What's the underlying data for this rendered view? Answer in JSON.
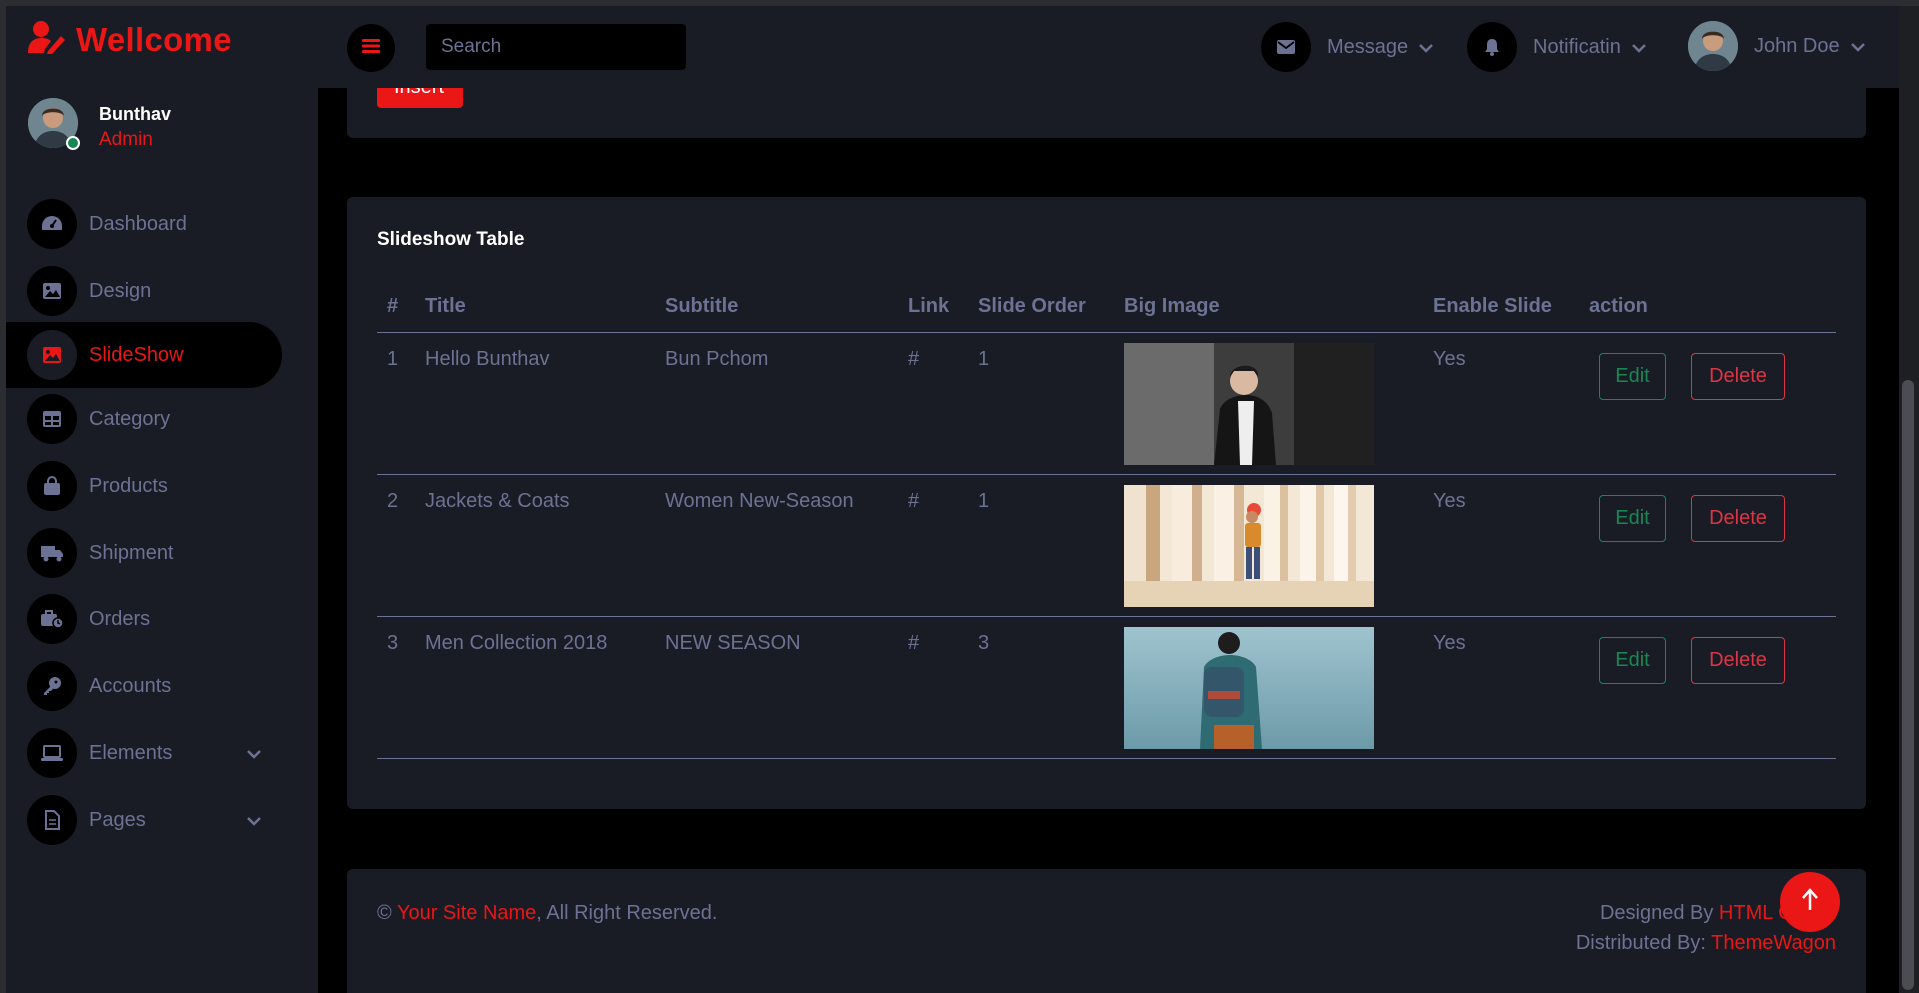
{
  "brand": {
    "name": "Wellcome",
    "icon": "user-edit-icon"
  },
  "profile": {
    "name": "Bunthav",
    "role": "Admin",
    "status_color": "#198754"
  },
  "nav": [
    {
      "label": "Dashboard",
      "icon": "tachometer-icon",
      "active": false
    },
    {
      "label": "Design",
      "icon": "image-icon",
      "active": false
    },
    {
      "label": "SlideShow",
      "icon": "image-icon",
      "active": true
    },
    {
      "label": "Category",
      "icon": "table-icon",
      "active": false
    },
    {
      "label": "Products",
      "icon": "shopping-bag-icon",
      "active": false
    },
    {
      "label": "Shipment",
      "icon": "truck-icon",
      "active": false
    },
    {
      "label": "Orders",
      "icon": "briefcase-clock-icon",
      "active": false
    },
    {
      "label": "Accounts",
      "icon": "key-icon",
      "active": false
    },
    {
      "label": "Elements",
      "icon": "laptop-icon",
      "active": false,
      "has_dropdown": true
    },
    {
      "label": "Pages",
      "icon": "file-icon",
      "active": false,
      "has_dropdown": true
    }
  ],
  "topbar": {
    "search_placeholder": "Search",
    "message_label": "Message",
    "notification_label": "Notificatin",
    "user_name": "John Doe"
  },
  "insert_label": "Insert",
  "table": {
    "title": "Slideshow Table",
    "columns": [
      "#",
      "Title",
      "Subtitle",
      "Link",
      "Slide Order",
      "Big Image",
      "Enable Slide",
      "action"
    ],
    "rows": [
      {
        "num": "1",
        "title": "Hello Bunthav",
        "subtitle": "Bun Pchom",
        "link": "#",
        "order": "1",
        "image": "man-black-coat-photo",
        "enabled": "Yes"
      },
      {
        "num": "2",
        "title": "Jackets & Coats",
        "subtitle": "Women New-Season",
        "link": "#",
        "order": "1",
        "image": "man-columns-photo",
        "enabled": "Yes"
      },
      {
        "num": "3",
        "title": "Men Collection 2018",
        "subtitle": "NEW SEASON",
        "link": "#",
        "order": "3",
        "image": "man-backpack-beach-photo",
        "enabled": "Yes"
      }
    ],
    "edit_label": "Edit",
    "delete_label": "Delete"
  },
  "footer": {
    "copyright": "©",
    "site_name": "Your Site Name",
    "rights": ", All Right Reserved.",
    "designed_by": "Designed By",
    "designer": "HTML Codex",
    "distributed_by": "Distributed By:",
    "distributor": "ThemeWagon"
  },
  "colors": {
    "accent": "#eb1616",
    "card_bg": "#191c24",
    "text": "#6c7293",
    "success": "#198754",
    "danger": "#dc3545"
  }
}
